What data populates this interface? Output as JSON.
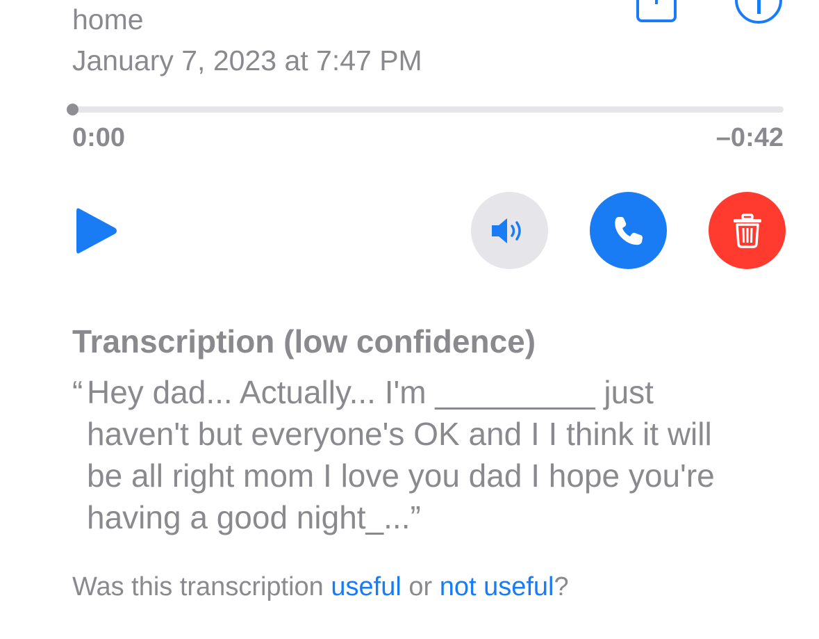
{
  "header": {
    "label": "home",
    "datetime": "January 7, 2023 at 7:47 PM"
  },
  "icons": {
    "share": "share-icon",
    "info": "info-icon",
    "play": "play-icon",
    "speaker": "speaker-icon",
    "call": "phone-icon",
    "delete": "trash-icon"
  },
  "player": {
    "elapsed": "0:00",
    "remaining": "–0:42",
    "progress": 0
  },
  "colors": {
    "accent": "#1a7cf5",
    "destructive": "#ff3b30",
    "speaker_bg": "#e5e5ea",
    "text_secondary": "#8a8a8e"
  },
  "transcription": {
    "heading": "Transcription (low confidence)",
    "open_quote": "“",
    "lines": [
      "Hey dad... Actually... I'm _________ just",
      "haven't but everyone's OK and I I think it will",
      "be all right mom I love you dad I hope you're",
      "having a good night_...”"
    ]
  },
  "feedback": {
    "prefix": "Was this transcription ",
    "useful": "useful",
    "middle": " or ",
    "not_useful": "not useful",
    "suffix": "?"
  }
}
